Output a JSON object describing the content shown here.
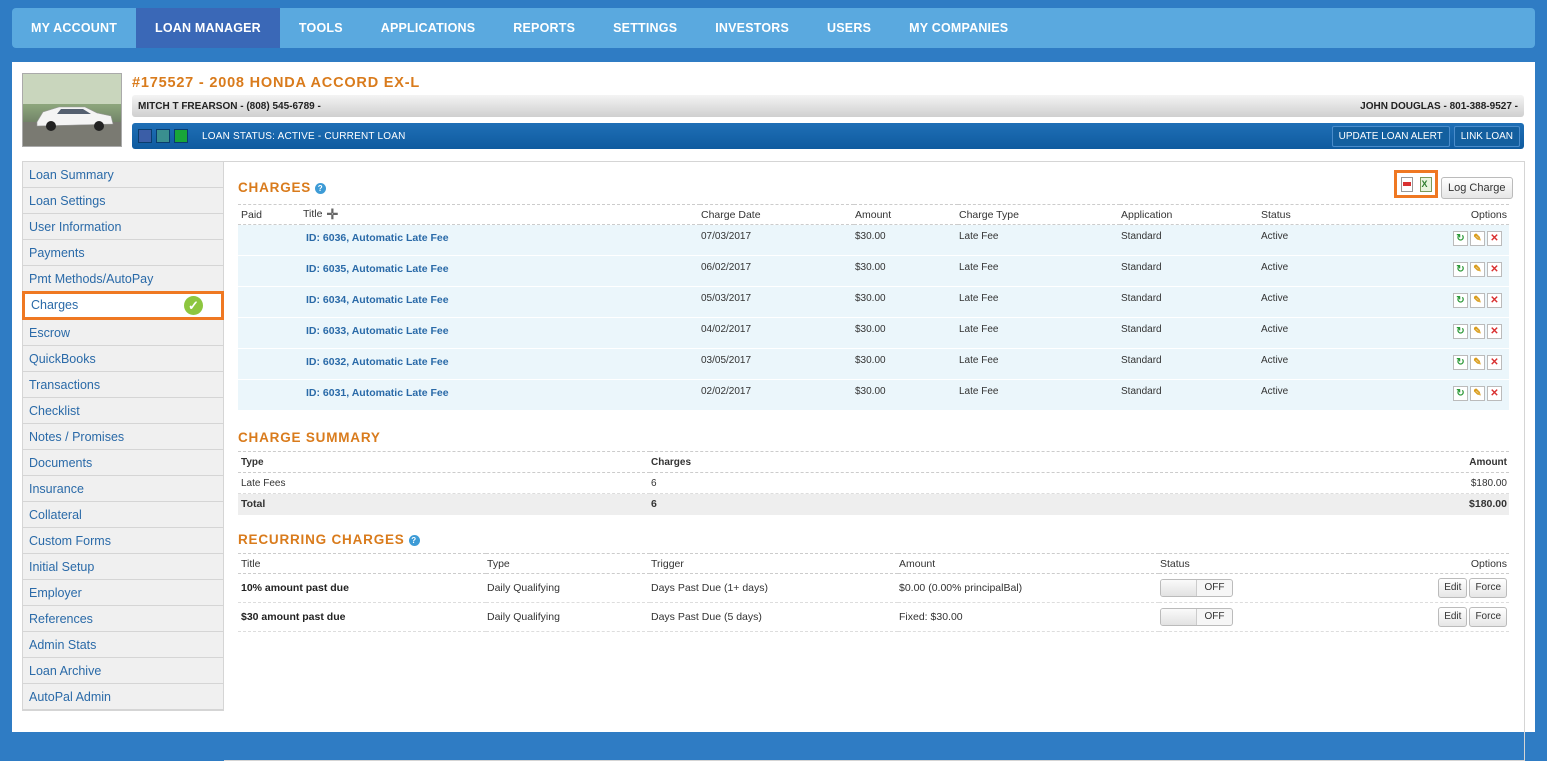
{
  "nav": [
    "MY ACCOUNT",
    "LOAN MANAGER",
    "TOOLS",
    "APPLICATIONS",
    "REPORTS",
    "SETTINGS",
    "INVESTORS",
    "USERS",
    "MY COMPANIES"
  ],
  "header": {
    "title": "#175527 - 2008 HONDA ACCORD EX-L",
    "borrower": "MITCH T FREARSON - (808) 545-6789 -",
    "dealer": "JOHN DOUGLAS - 801-388-9527 -",
    "swatch_colors": [
      "#3b5ea7",
      "#3a8f8f",
      "#18a639"
    ],
    "loan_status": "LOAN STATUS: ACTIVE - CURRENT LOAN",
    "update_alert": "UPDATE LOAN ALERT",
    "link_loan": "LINK LOAN"
  },
  "sidebar": [
    "Loan Summary",
    "Loan Settings",
    "User Information",
    "Payments",
    "Pmt Methods/AutoPay",
    "Charges",
    "Escrow",
    "QuickBooks",
    "Transactions",
    "Checklist",
    "Notes / Promises",
    "Documents",
    "Insurance",
    "Collateral",
    "Custom Forms",
    "Initial Setup",
    "Employer",
    "References",
    "Admin Stats",
    "Loan Archive",
    "AutoPal Admin"
  ],
  "charges": {
    "title": "CHARGES",
    "log_button": "Log Charge",
    "headers": {
      "paid": "Paid",
      "title": "Title",
      "date": "Charge Date",
      "amount": "Amount",
      "type": "Charge Type",
      "application": "Application",
      "status": "Status",
      "options": "Options"
    },
    "rows": [
      {
        "title": "ID: 6036, Automatic Late Fee",
        "date": "07/03/2017",
        "amount": "$30.00",
        "type": "Late Fee",
        "application": "Standard",
        "status": "Active"
      },
      {
        "title": "ID: 6035, Automatic Late Fee",
        "date": "06/02/2017",
        "amount": "$30.00",
        "type": "Late Fee",
        "application": "Standard",
        "status": "Active"
      },
      {
        "title": "ID: 6034, Automatic Late Fee",
        "date": "05/03/2017",
        "amount": "$30.00",
        "type": "Late Fee",
        "application": "Standard",
        "status": "Active"
      },
      {
        "title": "ID: 6033, Automatic Late Fee",
        "date": "04/02/2017",
        "amount": "$30.00",
        "type": "Late Fee",
        "application": "Standard",
        "status": "Active"
      },
      {
        "title": "ID: 6032, Automatic Late Fee",
        "date": "03/05/2017",
        "amount": "$30.00",
        "type": "Late Fee",
        "application": "Standard",
        "status": "Active"
      },
      {
        "title": "ID: 6031, Automatic Late Fee",
        "date": "02/02/2017",
        "amount": "$30.00",
        "type": "Late Fee",
        "application": "Standard",
        "status": "Active"
      }
    ]
  },
  "summary": {
    "title": "CHARGE SUMMARY",
    "headers": {
      "type": "Type",
      "charges": "Charges",
      "amount": "Amount"
    },
    "row": {
      "type": "Late Fees",
      "charges": "6",
      "amount": "$180.00"
    },
    "total": {
      "label": "Total",
      "charges": "6",
      "amount": "$180.00"
    }
  },
  "recurring": {
    "title": "RECURRING CHARGES",
    "headers": {
      "title": "Title",
      "type": "Type",
      "trigger": "Trigger",
      "amount": "Amount",
      "status": "Status",
      "options": "Options"
    },
    "rows": [
      {
        "title": "10% amount past due",
        "type": "Daily Qualifying",
        "trigger": "Days Past Due (1+ days)",
        "amount": "$0.00 (0.00% principalBal)",
        "status": "OFF",
        "edit": "Edit",
        "force": "Force"
      },
      {
        "title": "$30 amount past due",
        "type": "Daily Qualifying",
        "trigger": "Days Past Due (5 days)",
        "amount": "Fixed: $30.00",
        "status": "OFF",
        "edit": "Edit",
        "force": "Force"
      }
    ]
  }
}
